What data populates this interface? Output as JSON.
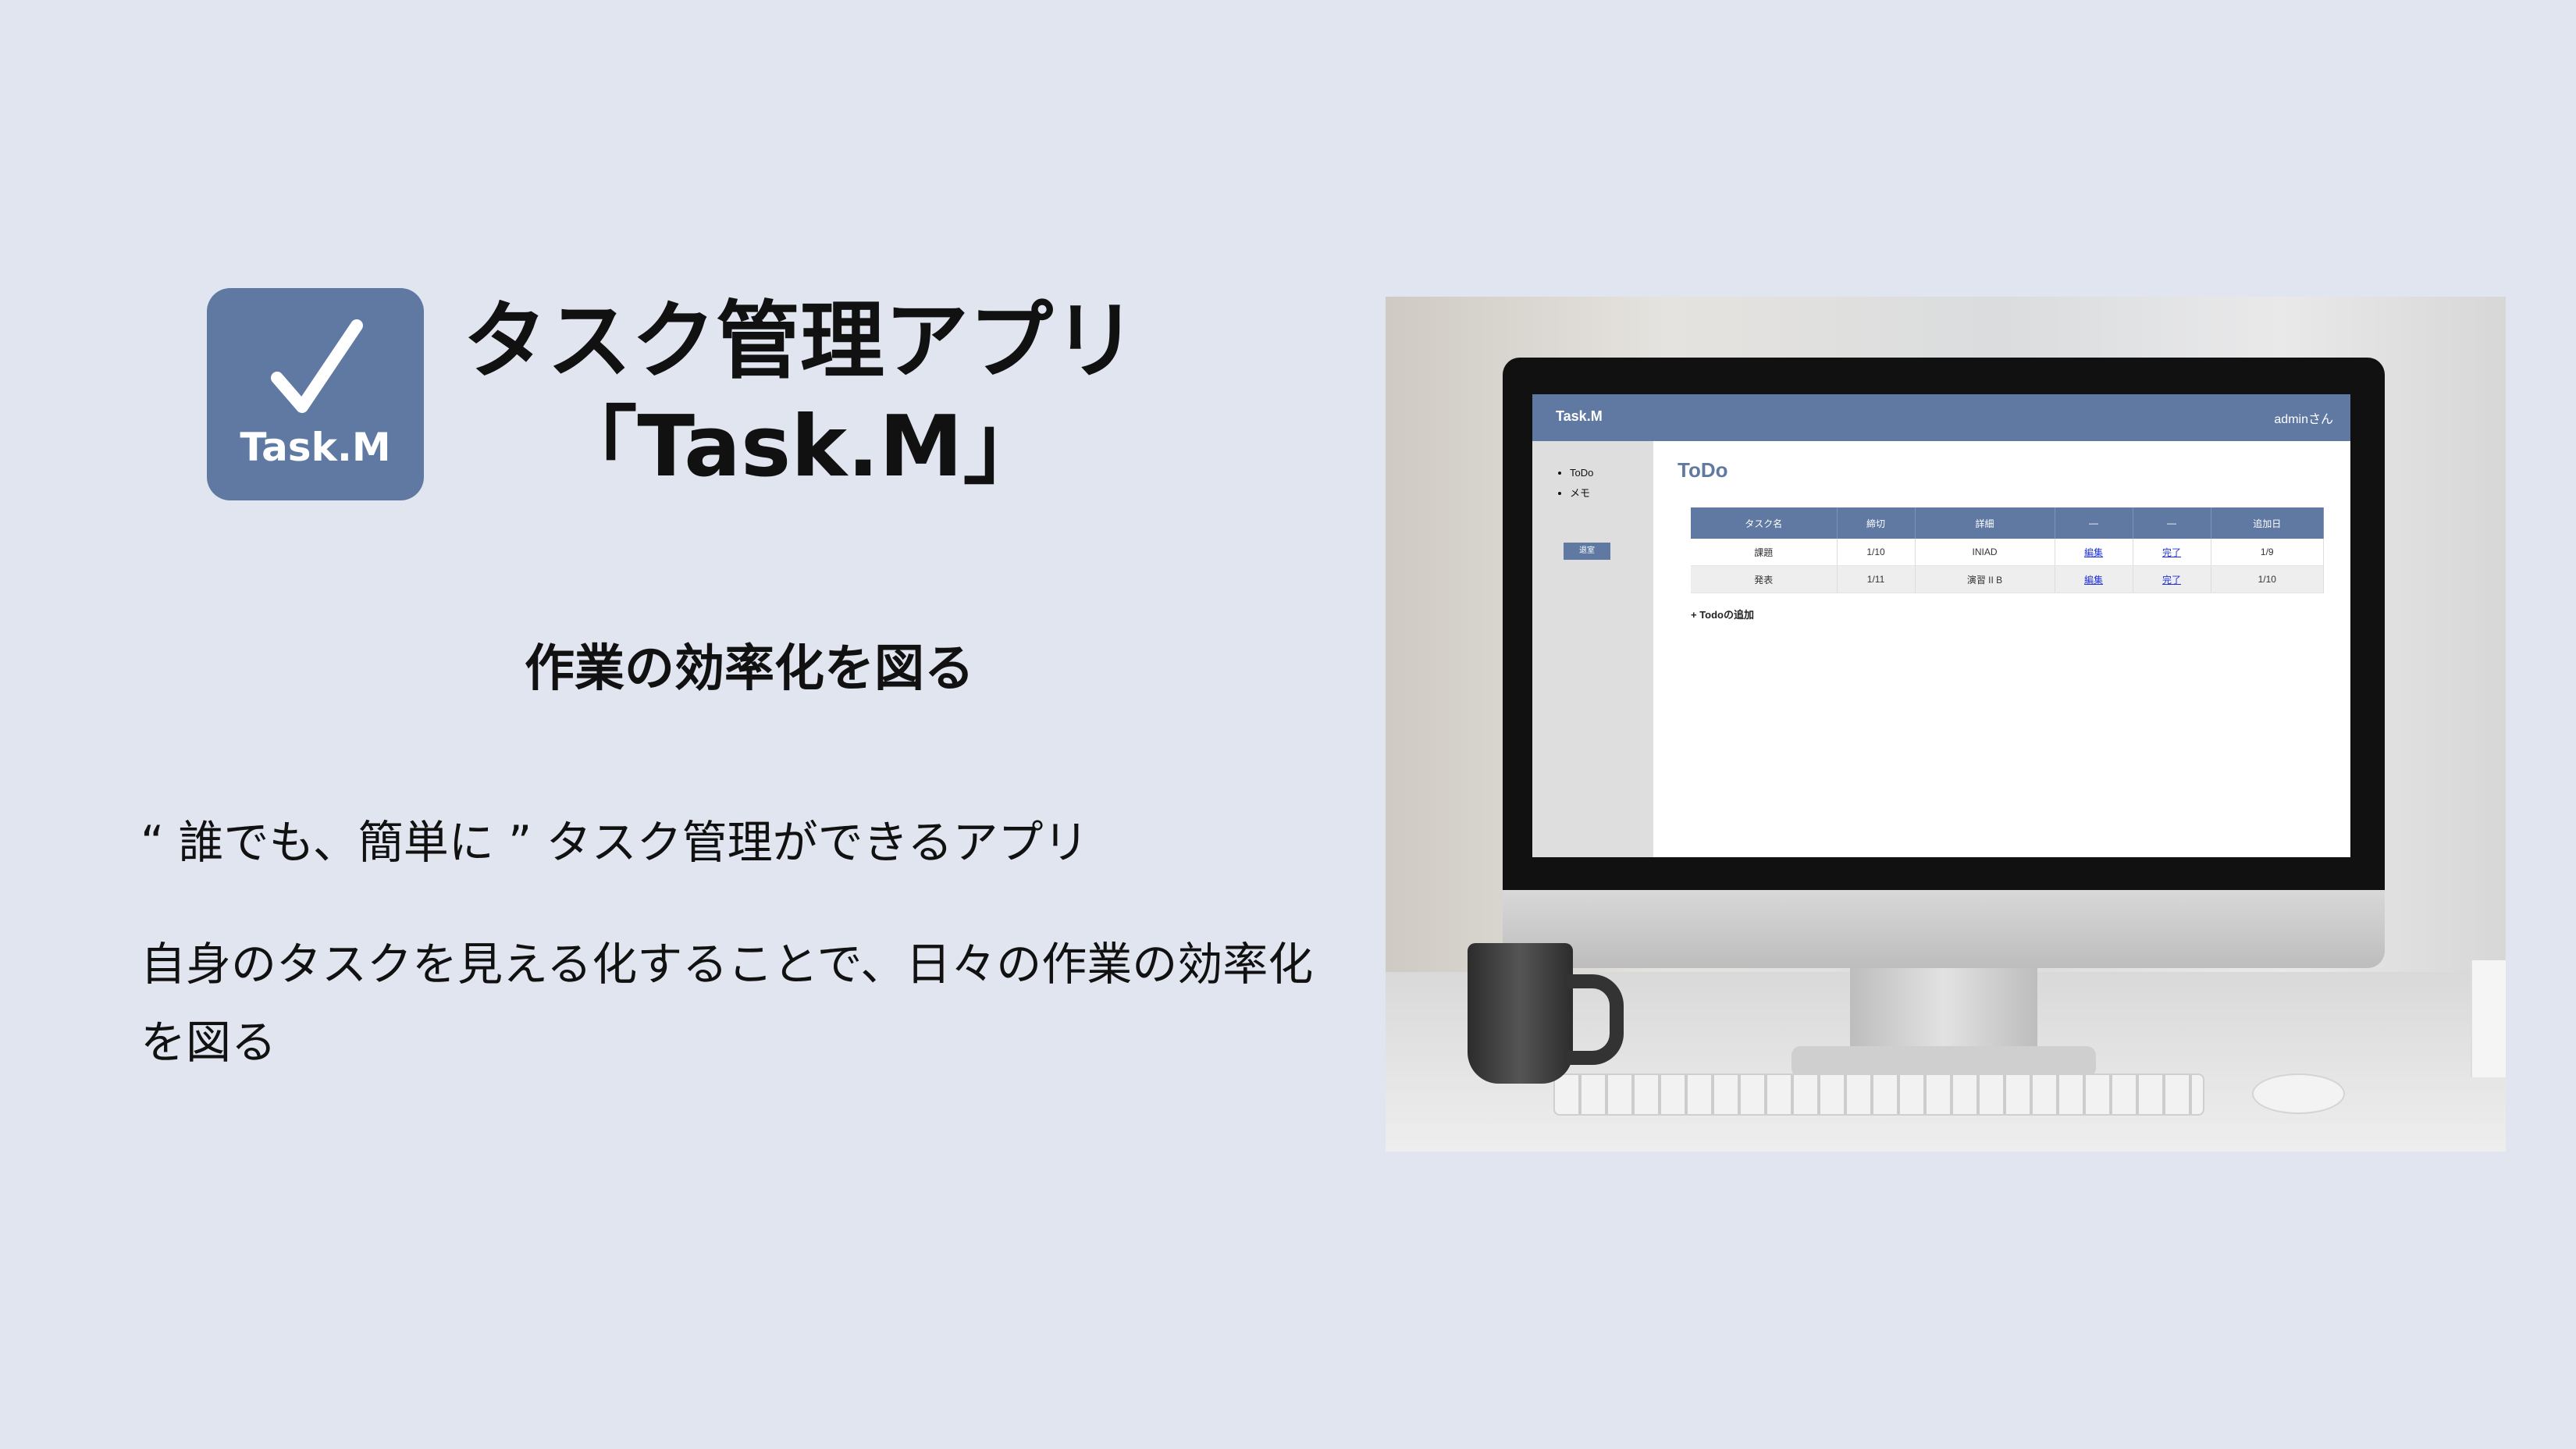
{
  "logo": {
    "icon": "checkmark-icon",
    "text": "Task.M",
    "color": "#5f79a3"
  },
  "title": {
    "line1": "タスク管理アプリ",
    "line2": "「Task.M」"
  },
  "subtitle": "作業の効率化を図る",
  "description": {
    "line1": "“ 誰でも、簡単に ” タスク管理ができるアプリ",
    "line2": "自身のタスクを見える化することで、日々の作業の効率化を図る"
  },
  "screen": {
    "brand": "Task.M",
    "user": "adminさん",
    "nav": [
      "ToDo",
      "メモ"
    ],
    "logout_label": "退室",
    "page_title": "ToDo",
    "table": {
      "headers": [
        "タスク名",
        "締切",
        "詳細",
        "—",
        "—",
        "追加日"
      ],
      "rows": [
        [
          "課題",
          "1/10",
          "INIAD",
          "編集",
          "完了",
          "1/9"
        ],
        [
          "発表",
          "1/11",
          "演習 II B",
          "編集",
          "完了",
          "1/10"
        ]
      ]
    },
    "add_label": "+ Todoの追加"
  }
}
